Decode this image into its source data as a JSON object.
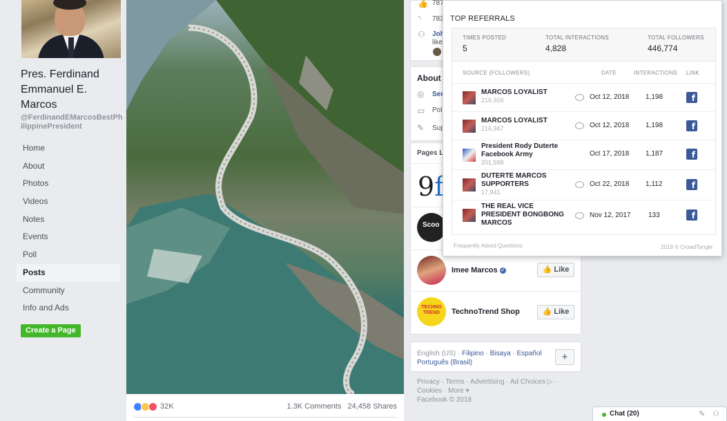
{
  "page": {
    "name": "Pres. Ferdinand Emmanuel E. Marcos",
    "handle": "@FerdinandEMarcosBestPhilippinePresident"
  },
  "nav": {
    "items": [
      "Home",
      "About",
      "Photos",
      "Videos",
      "Notes",
      "Events",
      "Poll",
      "Posts",
      "Community",
      "Info and Ads"
    ],
    "active": "Posts",
    "create_page": "Create a Page"
  },
  "post": {
    "reaction_count": "32K",
    "comments": "1.3K Comments",
    "shares": "24,458 Shares"
  },
  "right_column": {
    "top_card": {
      "row1": "787",
      "row2": "783",
      "row3": "Joh",
      "row3b": "like"
    },
    "about": {
      "title": "About",
      "row1": "Sen",
      "row2": "Pol",
      "row3": "Sup"
    },
    "pages_liked": {
      "title": "Pages Li",
      "pages": [
        {
          "name": "Imee Marcos",
          "verified": true,
          "like_label": "Like"
        },
        {
          "name": "TechnoTrend Shop",
          "verified": false,
          "like_label": "Like"
        }
      ]
    },
    "languages": {
      "current": "English (US)",
      "options": [
        "Filipino",
        "Bisaya",
        "Español",
        "Português (Brasil)"
      ],
      "plus": "+"
    },
    "footer": {
      "links": "Privacy · Terms · Advertising · Ad Choices ▷ · Cookies · More ▾",
      "copyright": "Facebook © 2018"
    }
  },
  "crowdtangle": {
    "title": "TOP REFERRALS",
    "stats": [
      {
        "label": "TIMES POSTED",
        "value": "5"
      },
      {
        "label": "TOTAL INTERACTIONS",
        "value": "4,828"
      },
      {
        "label": "TOTAL FOLLOWERS",
        "value": "446,774"
      }
    ],
    "columns": [
      "SOURCE (FOLLOWERS)",
      "DATE",
      "INTERACTIONS",
      "LINK"
    ],
    "rows": [
      {
        "name": "MARCOS LOYALIST",
        "followers": "216,916",
        "date": "Oct 12, 2018",
        "interactions": "1,198",
        "comment": true
      },
      {
        "name": "MARCOS LOYALIST",
        "followers": "216,947",
        "date": "Oct 12, 2018",
        "interactions": "1,198",
        "comment": true
      },
      {
        "name": "President Rody Duterte Facebook Army",
        "followers": "201,588",
        "date": "Oct 17, 2018",
        "interactions": "1,187",
        "comment": false
      },
      {
        "name": "DUTERTE MARCOS SUPPORTERS",
        "followers": "17,941",
        "date": "Oct 22, 2018",
        "interactions": "1,112",
        "comment": true
      },
      {
        "name": "THE REAL VICE PRESIDENT BONGBONG MARCOS",
        "followers": "",
        "date": "Nov 12, 2017",
        "interactions": "133",
        "comment": true
      }
    ],
    "faq": "Frequently Asked Questions",
    "copyright": "2018 © CrowdTangle"
  },
  "chat": {
    "label": "Chat (20)"
  },
  "colors": {
    "brand": "#3b5998",
    "green": "#42b72a",
    "link": "#385898"
  }
}
